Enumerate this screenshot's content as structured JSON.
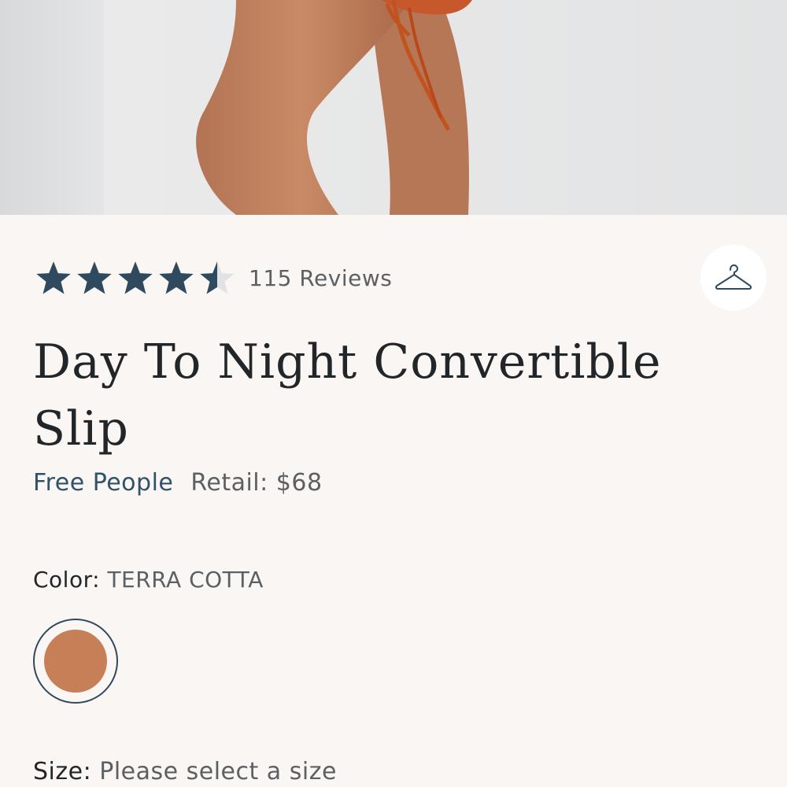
{
  "product": {
    "rating": {
      "stars_value": 4.5,
      "stars_max": 5,
      "reviews_label": "115 Reviews"
    },
    "title": "Day To Night Convertible Slip",
    "brand": "Free People",
    "retail_label": "Retail: $68",
    "color": {
      "label": "Color:",
      "value": "TERRA COTTA",
      "swatch_hex": "#c77f58"
    },
    "size": {
      "label": "Size:",
      "value": "Please select a size"
    },
    "closet_icon": "hanger-icon"
  },
  "colors": {
    "accent": "#2f4a5e",
    "star_filled": "#2f4a5e",
    "star_empty": "#dfe3e6",
    "background": "#f9f6f3",
    "text_primary": "#232628",
    "text_secondary": "#5d6063"
  }
}
